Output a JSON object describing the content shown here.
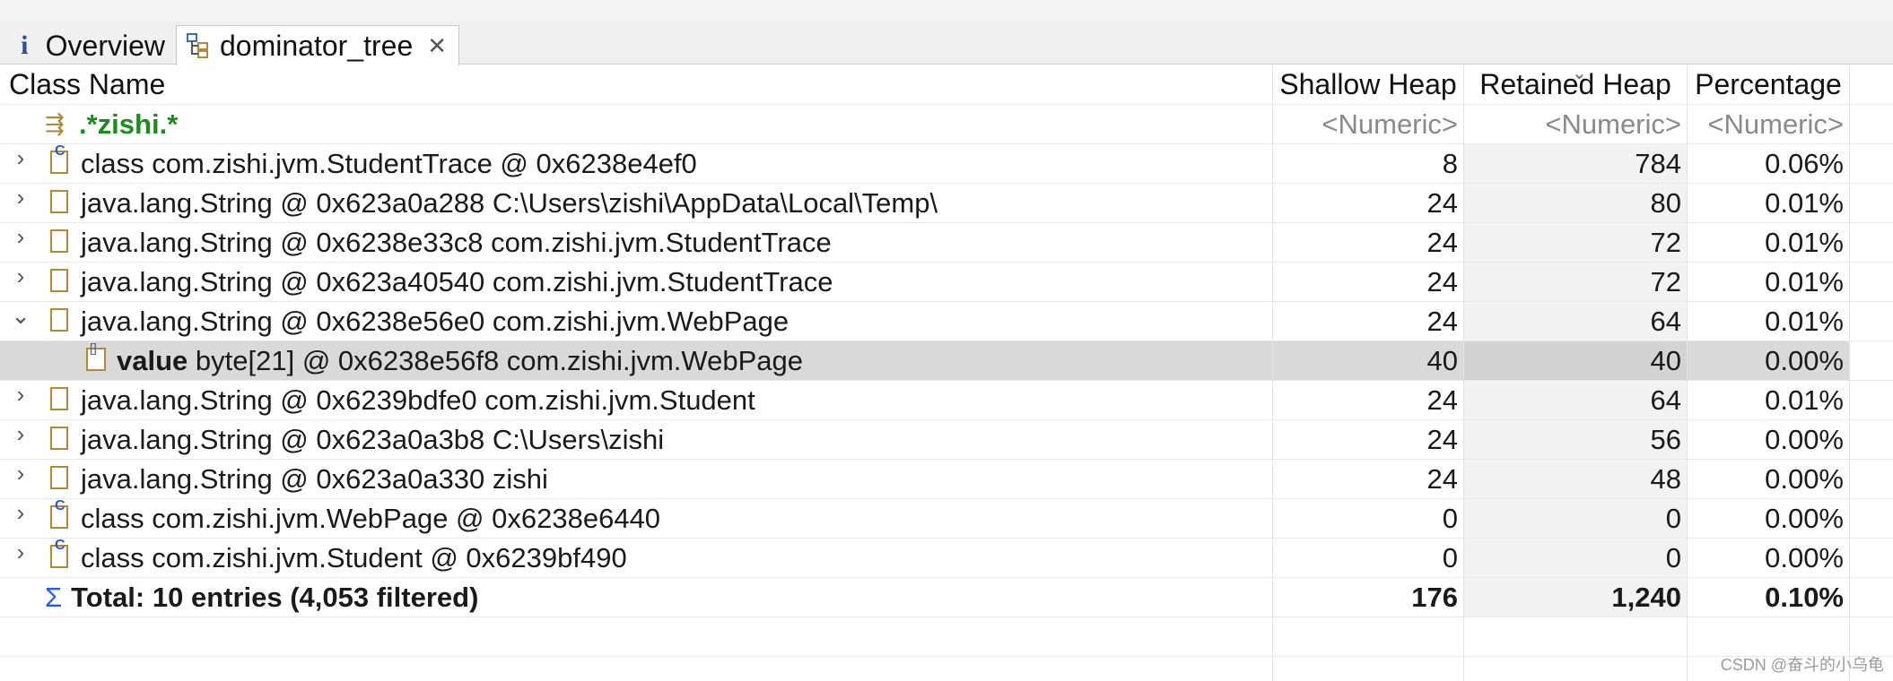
{
  "tabs": [
    {
      "label": "Overview",
      "icon": "info-icon"
    },
    {
      "label": "dominator_tree",
      "icon": "dominator-tree-icon",
      "closable": true
    }
  ],
  "columns": {
    "class_name": "Class Name",
    "shallow_heap": "Shallow Heap",
    "retained_heap": "Retained Heap",
    "percentage": "Percentage"
  },
  "filter": {
    "regex": ".*zishi.*",
    "shallow": "<Numeric>",
    "retained": "<Numeric>",
    "percentage": "<Numeric>"
  },
  "rows": [
    {
      "twisty": ">",
      "icon": "class",
      "name": "class com.zishi.jvm.StudentTrace @ 0x6238e4ef0",
      "shallow": "8",
      "retained": "784",
      "percentage": "0.06%"
    },
    {
      "twisty": ">",
      "icon": "object",
      "name": "java.lang.String @ 0x623a0a288  C:\\Users\\zishi\\AppData\\Local\\Temp\\",
      "shallow": "24",
      "retained": "80",
      "percentage": "0.01%"
    },
    {
      "twisty": ">",
      "icon": "object",
      "name": "java.lang.String @ 0x6238e33c8  com.zishi.jvm.StudentTrace",
      "shallow": "24",
      "retained": "72",
      "percentage": "0.01%"
    },
    {
      "twisty": ">",
      "icon": "object",
      "name": "java.lang.String @ 0x623a40540  com.zishi.jvm.StudentTrace",
      "shallow": "24",
      "retained": "72",
      "percentage": "0.01%"
    },
    {
      "twisty": "v",
      "icon": "object",
      "name": "java.lang.String @ 0x6238e56e0  com.zishi.jvm.WebPage",
      "shallow": "24",
      "retained": "64",
      "percentage": "0.01%"
    },
    {
      "child": true,
      "icon": "array",
      "field": "value",
      "name": "byte[21] @ 0x6238e56f8  com.zishi.jvm.WebPage",
      "shallow": "40",
      "retained": "40",
      "percentage": "0.00%"
    },
    {
      "twisty": ">",
      "icon": "object",
      "name": "java.lang.String @ 0x6239bdfe0  com.zishi.jvm.Student",
      "shallow": "24",
      "retained": "64",
      "percentage": "0.01%"
    },
    {
      "twisty": ">",
      "icon": "object",
      "name": "java.lang.String @ 0x623a0a3b8  C:\\Users\\zishi",
      "shallow": "24",
      "retained": "56",
      "percentage": "0.00%"
    },
    {
      "twisty": ">",
      "icon": "object",
      "name": "java.lang.String @ 0x623a0a330  zishi",
      "shallow": "24",
      "retained": "48",
      "percentage": "0.00%"
    },
    {
      "twisty": ">",
      "icon": "class",
      "name": "class com.zishi.jvm.WebPage @ 0x6238e6440",
      "shallow": "0",
      "retained": "0",
      "percentage": "0.00%"
    },
    {
      "twisty": ">",
      "icon": "class",
      "name": "class com.zishi.jvm.Student @ 0x6239bf490",
      "shallow": "0",
      "retained": "0",
      "percentage": "0.00%"
    }
  ],
  "total": {
    "sigma": "Σ",
    "label": "Total: 10 entries (4,053 filtered)",
    "shallow": "176",
    "retained": "1,240",
    "percentage": "0.10%"
  },
  "watermark": "CSDN @奋斗的小乌龟"
}
